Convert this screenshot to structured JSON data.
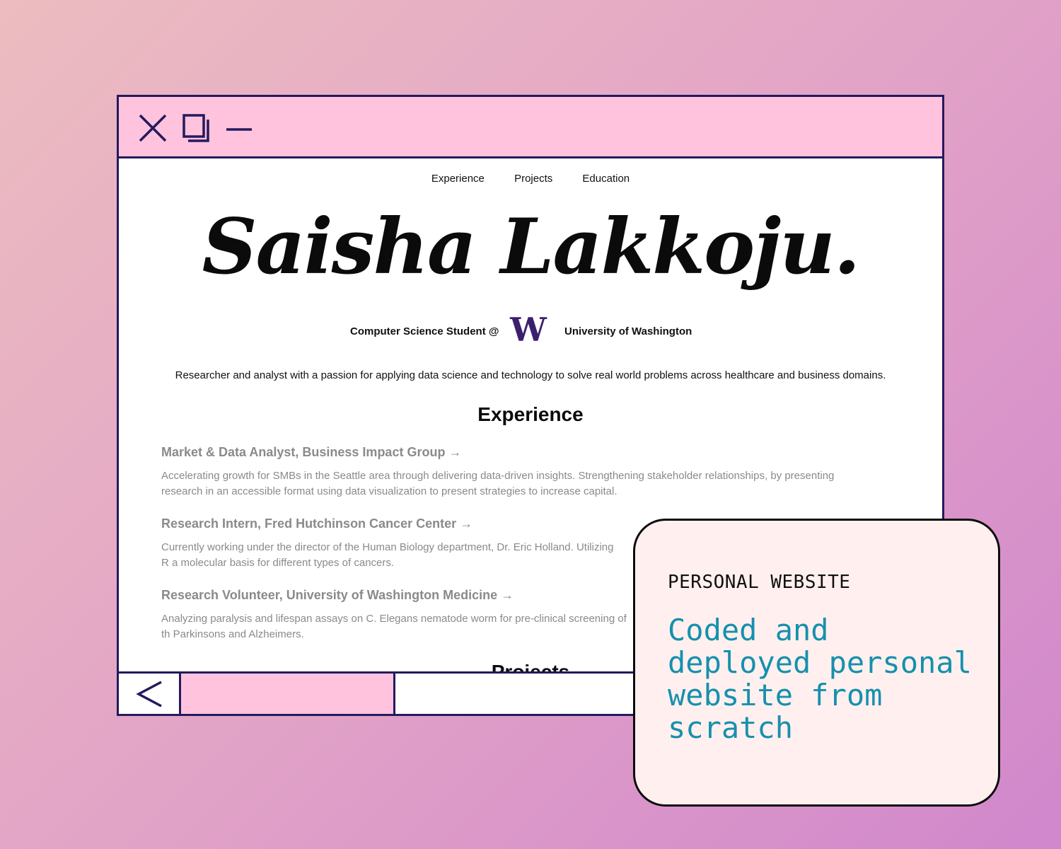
{
  "nav": {
    "experience": "Experience",
    "projects": "Projects",
    "education": "Education"
  },
  "hero": {
    "name": "Saisha Lakkoju.",
    "subtitle_left": "Computer Science Student @",
    "logo_letter": "W",
    "subtitle_right": "University of Washington",
    "tagline": "Researcher and analyst with a passion for applying data science and technology to solve real world problems across healthcare and business domains."
  },
  "experience": {
    "heading": "Experience",
    "items": [
      {
        "title": "Market & Data Analyst, Business Impact Group →",
        "desc": "Accelerating growth for SMBs in the Seattle area through delivering data-driven insights. Strengthening stakeholder relationships, by presenting research in an accessible format using data visualization to present strategies to increase capital."
      },
      {
        "title": "Research Intern, Fred Hutchinson Cancer Center →",
        "desc": "Currently working under the director of the Human Biology department, Dr. Eric Holland. Utilizing R a molecular basis for different types of cancers."
      },
      {
        "title": "Research Volunteer, University of Washington Medicine →",
        "desc": "Analyzing paralysis and lifespan assays on C. Elegans nematode worm for pre-clinical screening of th Parkinsons and Alzheimers."
      }
    ]
  },
  "projects": {
    "heading": "Projects"
  },
  "card": {
    "label": "PERSONAL WEBSITE",
    "body": "Coded and deployed personal website from scratch"
  },
  "colors": {
    "frame": "#241a5e",
    "titlebar": "#ffc3de",
    "uw_purple": "#3b1f6e",
    "card_text": "#1690ad",
    "card_bg": "#fff0ef"
  },
  "icons": {
    "close": "close-icon",
    "restore": "restore-icon",
    "minimize": "minimize-icon",
    "back": "chevron-left-icon",
    "logo": "uw-logo-icon"
  }
}
